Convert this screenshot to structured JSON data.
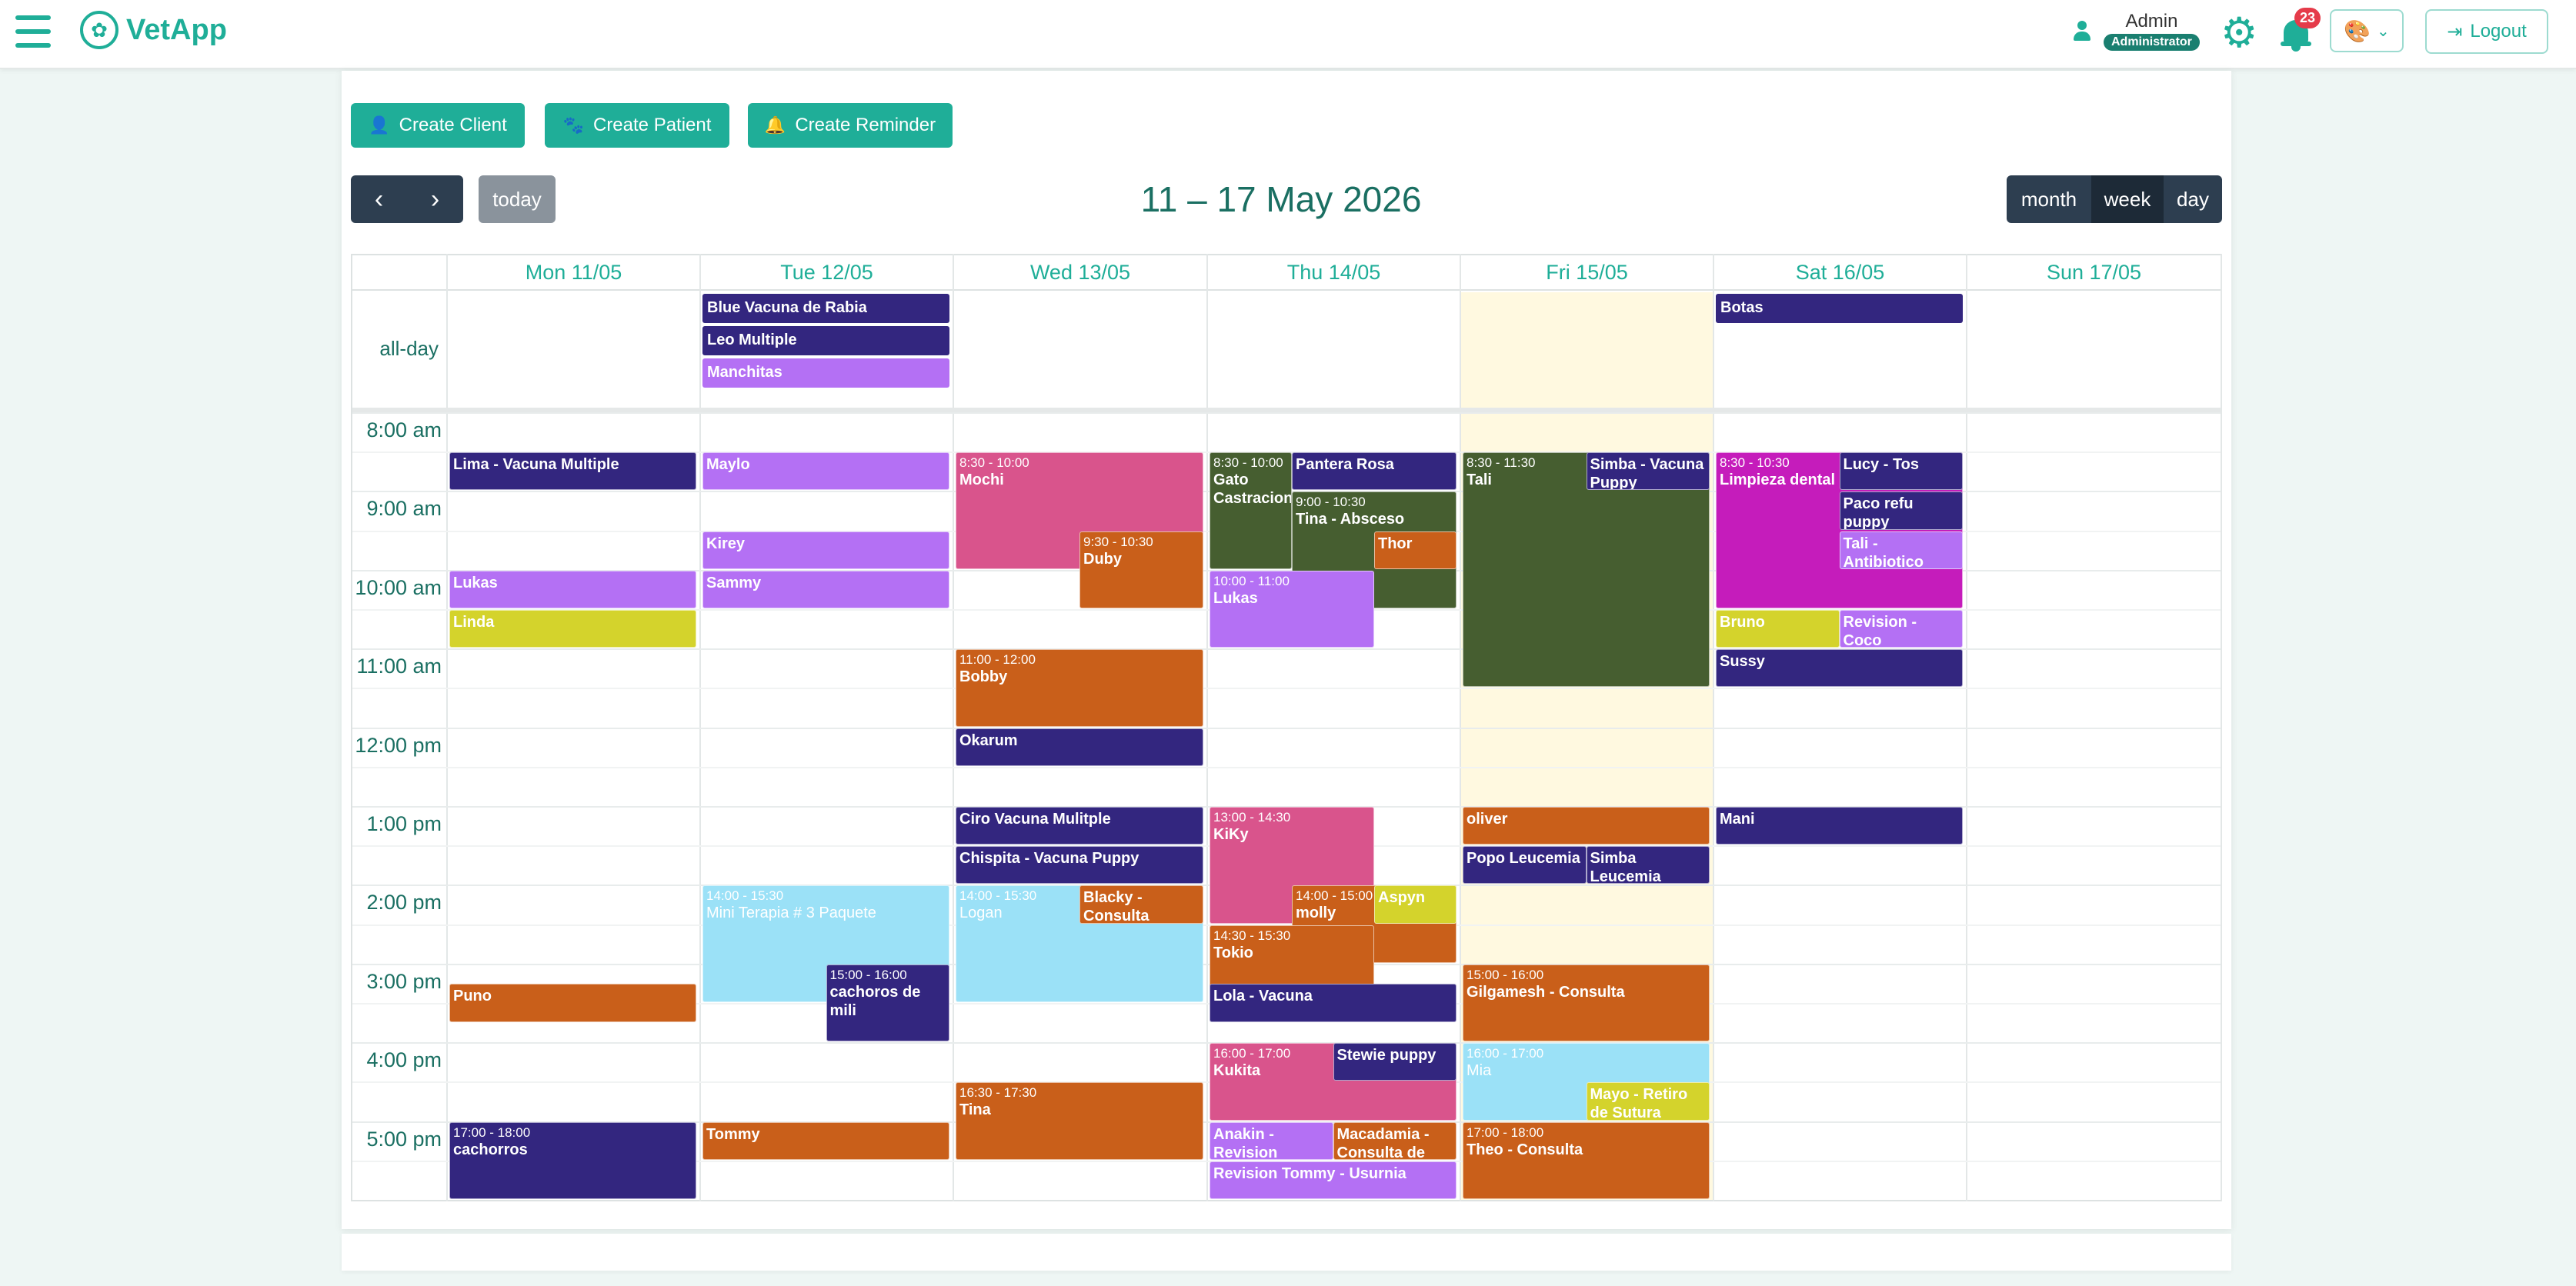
{
  "app": {
    "name": "VetApp"
  },
  "user": {
    "name": "Admin",
    "role": "Administrator",
    "notification_count": "23"
  },
  "header": {
    "logout_label": "Logout"
  },
  "actions": {
    "create_client": "Create Client",
    "create_patient": "Create Patient",
    "create_reminder": "Create Reminder"
  },
  "toolbar": {
    "prev": "‹",
    "next": "›",
    "today": "today",
    "title": "11 – 17 May 2026",
    "views": [
      "month",
      "week",
      "day"
    ],
    "active_view": "week"
  },
  "days": [
    "Mon 11/05",
    "Tue 12/05",
    "Wed 13/05",
    "Thu 14/05",
    "Fri 15/05",
    "Sat 16/05",
    "Sun 17/05"
  ],
  "allday_label": "all-day",
  "hours": [
    "8:00 am",
    "9:00 am",
    "10:00 am",
    "11:00 am",
    "12:00 pm",
    "1:00 pm",
    "2:00 pm",
    "3:00 pm",
    "4:00 pm",
    "5:00 pm"
  ],
  "colors": {
    "primary": "#1fae98",
    "indigo": "#33267f",
    "lilac": "#b470f4",
    "pink": "#d9548c",
    "orange": "#c95f1a",
    "olive": "#465e30",
    "magenta": "#c51cbb",
    "lime": "#d4d32c",
    "sky": "#9be1f7",
    "today_bg": "#fff9e0"
  },
  "allday_events": [
    {
      "day": 1,
      "row": 0,
      "title": "Blue Vacuna de Rabia",
      "color": "#33267f"
    },
    {
      "day": 1,
      "row": 1,
      "title": "Leo Multiple",
      "color": "#33267f"
    },
    {
      "day": 1,
      "row": 2,
      "title": "Manchitas",
      "color": "#b470f4"
    },
    {
      "day": 5,
      "row": 0,
      "title": "Botas",
      "color": "#33267f"
    }
  ],
  "events": [
    {
      "day": 0,
      "start": 8.5,
      "end": 9,
      "col": 0,
      "ncol": 1,
      "time": "",
      "title": "Lima - Vacuna Multiple",
      "color": "#33267f"
    },
    {
      "day": 0,
      "start": 10,
      "end": 10.5,
      "col": 0,
      "ncol": 1,
      "time": "",
      "title": "Lukas",
      "color": "#b470f4"
    },
    {
      "day": 0,
      "start": 10.5,
      "end": 11,
      "col": 0,
      "ncol": 1,
      "time": "",
      "title": "Linda",
      "color": "#d4d32c"
    },
    {
      "day": 0,
      "start": 15.25,
      "end": 15.75,
      "col": 0,
      "ncol": 1,
      "time": "",
      "title": "Puno",
      "color": "#c95f1a"
    },
    {
      "day": 0,
      "start": 17,
      "end": 18,
      "col": 0,
      "ncol": 1,
      "time": "17:00 - 18:00",
      "title": "cachorros",
      "color": "#33267f"
    },
    {
      "day": 1,
      "start": 8.5,
      "end": 9,
      "col": 0,
      "ncol": 1,
      "time": "",
      "title": "Maylo",
      "color": "#b470f4"
    },
    {
      "day": 1,
      "start": 9.5,
      "end": 10,
      "col": 0,
      "ncol": 1,
      "time": "",
      "title": "Kirey",
      "color": "#b470f4"
    },
    {
      "day": 1,
      "start": 10,
      "end": 10.5,
      "col": 0,
      "ncol": 1,
      "time": "",
      "title": "Sammy",
      "color": "#b470f4"
    },
    {
      "day": 1,
      "start": 14,
      "end": 15.5,
      "col": 0,
      "ncol": 1,
      "time": "14:00 - 15:30",
      "title": "Mini Terapia # 3 Paquete",
      "color": "#9be1f7"
    },
    {
      "day": 1,
      "start": 15,
      "end": 16,
      "col": 1,
      "ncol": 2,
      "time": "15:00 - 16:00",
      "title": "cachoros de mili",
      "color": "#33267f"
    },
    {
      "day": 1,
      "start": 17,
      "end": 17.5,
      "col": 0,
      "ncol": 1,
      "time": "",
      "title": "Tommy",
      "color": "#c95f1a"
    },
    {
      "day": 2,
      "start": 8.5,
      "end": 10,
      "col": 0,
      "ncol": 1,
      "time": "8:30 - 10:00",
      "title": "Mochi",
      "color": "#d9548c"
    },
    {
      "day": 2,
      "start": 9.5,
      "end": 10.5,
      "col": 1,
      "ncol": 2,
      "time": "9:30 - 10:30",
      "title": "Duby",
      "color": "#c95f1a"
    },
    {
      "day": 2,
      "start": 11,
      "end": 12,
      "col": 0,
      "ncol": 1,
      "time": "11:00 - 12:00",
      "title": "Bobby",
      "color": "#c95f1a"
    },
    {
      "day": 2,
      "start": 12,
      "end": 12.5,
      "col": 0,
      "ncol": 1,
      "time": "",
      "title": "Okarum",
      "color": "#33267f"
    },
    {
      "day": 2,
      "start": 13,
      "end": 13.5,
      "col": 0,
      "ncol": 1,
      "time": "",
      "title": "Ciro Vacuna Mulitple",
      "color": "#33267f"
    },
    {
      "day": 2,
      "start": 13.5,
      "end": 14,
      "col": 0,
      "ncol": 1,
      "time": "",
      "title": "Chispita - Vacuna Puppy",
      "color": "#33267f"
    },
    {
      "day": 2,
      "start": 14,
      "end": 15.5,
      "col": 0,
      "ncol": 1,
      "time": "14:00 - 15:30",
      "title": "Logan",
      "color": "#9be1f7"
    },
    {
      "day": 2,
      "start": 14,
      "end": 14.5,
      "col": 1,
      "ncol": 2,
      "time": "",
      "title": "Blacky - Consulta",
      "color": "#c95f1a"
    },
    {
      "day": 2,
      "start": 16.5,
      "end": 17.5,
      "col": 0,
      "ncol": 1,
      "time": "16:30 - 17:30",
      "title": "Tina",
      "color": "#c95f1a"
    },
    {
      "day": 3,
      "start": 8.5,
      "end": 10,
      "col": 0,
      "ncol": 3,
      "time": "8:30 - 10:00",
      "title": "Gato Castracion",
      "color": "#465e30"
    },
    {
      "day": 3,
      "start": 8.5,
      "end": 9,
      "col": 1,
      "ncol": 3,
      "span": 2,
      "time": "",
      "title": "Pantera Rosa",
      "color": "#33267f"
    },
    {
      "day": 3,
      "start": 9,
      "end": 10.5,
      "col": 1,
      "ncol": 3,
      "span": 2,
      "time": "9:00 - 10:30",
      "title": "Tina - Absceso",
      "color": "#465e30"
    },
    {
      "day": 3,
      "start": 9.5,
      "end": 10,
      "col": 2,
      "ncol": 3,
      "time": "",
      "title": "Thor",
      "color": "#c95f1a"
    },
    {
      "day": 3,
      "start": 10,
      "end": 11,
      "col": 0,
      "ncol": 3,
      "span": 2,
      "time": "10:00 - 11:00",
      "title": "Lukas",
      "color": "#b470f4"
    },
    {
      "day": 3,
      "start": 13,
      "end": 14.5,
      "col": 0,
      "ncol": 3,
      "span": 2,
      "time": "13:00 - 14:30",
      "title": "KiKy",
      "color": "#d9548c"
    },
    {
      "day": 3,
      "start": 14,
      "end": 15,
      "col": 1,
      "ncol": 3,
      "span": 2,
      "time": "14:00 - 15:00",
      "title": "molly",
      "color": "#c95f1a"
    },
    {
      "day": 3,
      "start": 14,
      "end": 14.5,
      "col": 2,
      "ncol": 3,
      "time": "",
      "title": "Aspyn",
      "color": "#d4d32c"
    },
    {
      "day": 3,
      "start": 14.5,
      "end": 15.5,
      "col": 0,
      "ncol": 3,
      "span": 2,
      "time": "14:30 - 15:30",
      "title": "Tokio",
      "color": "#c95f1a"
    },
    {
      "day": 3,
      "start": 15.25,
      "end": 15.75,
      "col": 0,
      "ncol": 1,
      "time": "",
      "title": "Lola - Vacuna",
      "color": "#33267f"
    },
    {
      "day": 3,
      "start": 16,
      "end": 17,
      "col": 0,
      "ncol": 1,
      "time": "16:00 - 17:00",
      "title": "Kukita",
      "color": "#d9548c"
    },
    {
      "day": 3,
      "start": 16,
      "end": 16.5,
      "col": 1,
      "ncol": 2,
      "time": "",
      "title": "Stewie puppy",
      "color": "#33267f"
    },
    {
      "day": 3,
      "start": 17,
      "end": 17.5,
      "col": 0,
      "ncol": 2,
      "time": "",
      "title": "Anakin - Revision",
      "color": "#b470f4"
    },
    {
      "day": 3,
      "start": 17,
      "end": 17.5,
      "col": 1,
      "ncol": 2,
      "time": "",
      "title": "Macadamia - Consulta de",
      "color": "#c95f1a"
    },
    {
      "day": 3,
      "start": 17.5,
      "end": 18,
      "col": 0,
      "ncol": 1,
      "time": "",
      "title": "Revision Tommy - Usurnia",
      "color": "#b470f4"
    },
    {
      "day": 4,
      "start": 8.5,
      "end": 11.5,
      "col": 0,
      "ncol": 1,
      "time": "8:30 - 11:30",
      "title": "Tali",
      "color": "#465e30"
    },
    {
      "day": 4,
      "start": 8.5,
      "end": 9,
      "col": 1,
      "ncol": 2,
      "time": "",
      "title": "Simba - Vacuna Puppy",
      "color": "#33267f"
    },
    {
      "day": 4,
      "start": 13,
      "end": 13.5,
      "col": 0,
      "ncol": 1,
      "time": "",
      "title": "oliver",
      "color": "#c95f1a"
    },
    {
      "day": 4,
      "start": 13.5,
      "end": 14,
      "col": 0,
      "ncol": 2,
      "time": "",
      "title": "Popo Leucemia",
      "color": "#33267f"
    },
    {
      "day": 4,
      "start": 13.5,
      "end": 14,
      "col": 1,
      "ncol": 2,
      "time": "",
      "title": "Simba Leucemia",
      "color": "#33267f"
    },
    {
      "day": 4,
      "start": 15,
      "end": 16,
      "col": 0,
      "ncol": 1,
      "time": "15:00 - 16:00",
      "title": "Gilgamesh - Consulta",
      "color": "#c95f1a"
    },
    {
      "day": 4,
      "start": 16,
      "end": 17,
      "col": 0,
      "ncol": 1,
      "time": "16:00 - 17:00",
      "title": "Mia",
      "color": "#9be1f7"
    },
    {
      "day": 4,
      "start": 16.5,
      "end": 17,
      "col": 1,
      "ncol": 2,
      "time": "",
      "title": "Mayo - Retiro de Sutura",
      "color": "#d4d32c"
    },
    {
      "day": 4,
      "start": 17,
      "end": 18,
      "col": 0,
      "ncol": 1,
      "time": "17:00 - 18:00",
      "title": "Theo - Consulta",
      "color": "#c95f1a"
    },
    {
      "day": 5,
      "start": 8.5,
      "end": 10.5,
      "col": 0,
      "ncol": 1,
      "time": "8:30 - 10:30",
      "title": "Limpieza dental de",
      "color": "#c51cbb"
    },
    {
      "day": 5,
      "start": 8.5,
      "end": 9,
      "col": 1,
      "ncol": 2,
      "time": "",
      "title": "Lucy - Tos",
      "color": "#33267f"
    },
    {
      "day": 5,
      "start": 9,
      "end": 9.5,
      "col": 1,
      "ncol": 2,
      "time": "",
      "title": "Paco refu puppy",
      "color": "#33267f"
    },
    {
      "day": 5,
      "start": 9.5,
      "end": 10,
      "col": 1,
      "ncol": 2,
      "time": "",
      "title": "Tali - Antibiotico",
      "color": "#b470f4"
    },
    {
      "day": 5,
      "start": 10.5,
      "end": 11,
      "col": 0,
      "ncol": 2,
      "time": "",
      "title": "Bruno",
      "color": "#d4d32c"
    },
    {
      "day": 5,
      "start": 10.5,
      "end": 11,
      "col": 1,
      "ncol": 2,
      "time": "",
      "title": "Revision - Coco",
      "color": "#b470f4"
    },
    {
      "day": 5,
      "start": 11,
      "end": 11.5,
      "col": 0,
      "ncol": 1,
      "time": "",
      "title": "Sussy",
      "color": "#33267f"
    },
    {
      "day": 5,
      "start": 13,
      "end": 13.5,
      "col": 0,
      "ncol": 1,
      "time": "",
      "title": "Mani",
      "color": "#33267f"
    }
  ]
}
